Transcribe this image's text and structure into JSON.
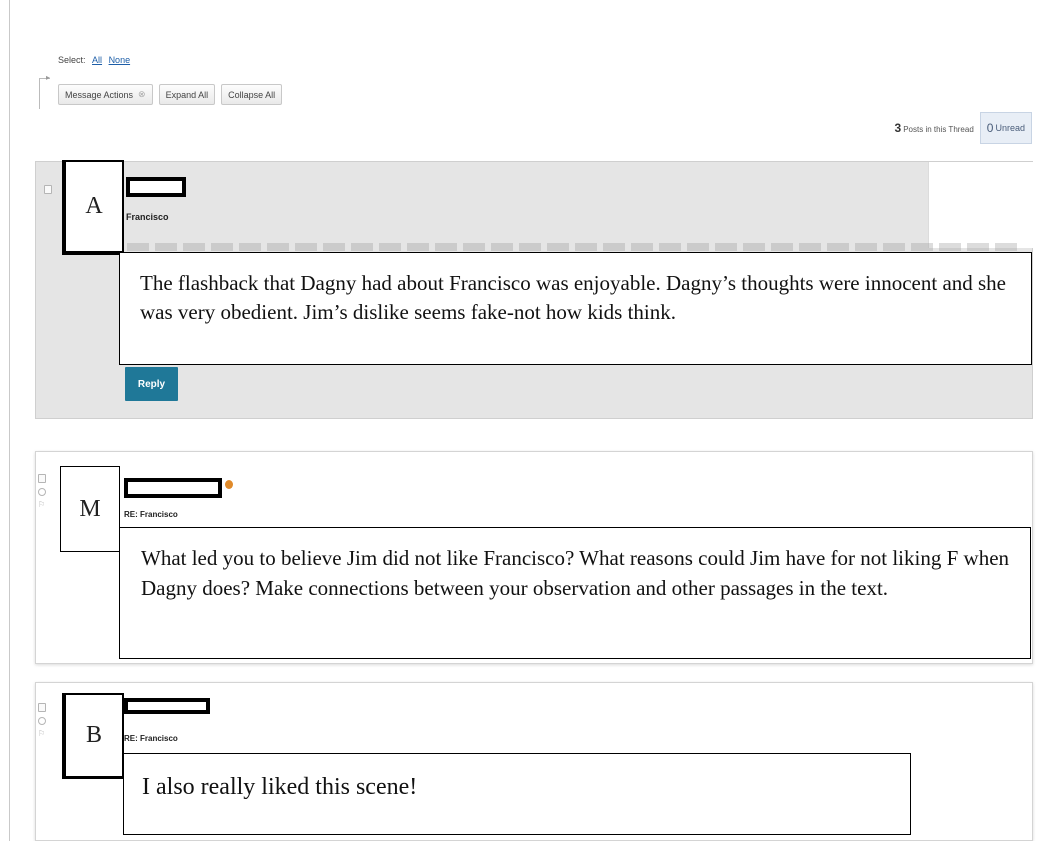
{
  "toolbar": {
    "select_label": "Select:",
    "select_all": "All",
    "select_none": "None",
    "message_actions": "Message Actions",
    "message_actions_icon": "close-icon",
    "expand_all": "Expand All",
    "collapse_all": "Collapse All"
  },
  "thread_info": {
    "posts_count": "3",
    "posts_label": "Posts in this Thread",
    "unread_count": "0",
    "unread_label": "Unread"
  },
  "posts": [
    {
      "marker": "A",
      "title": "Francisco",
      "callout": "The flashback that Dagny had about Francisco was enjoyable. Dagny’s thoughts were innocent and she was very obedient. Jim’s dislike seems fake-not how kids think.",
      "reply_label": "Reply"
    },
    {
      "marker": "M",
      "title": "RE: Francisco",
      "callout": "What led you to believe Jim did not like Francisco? What reasons could Jim have for not liking F when Dagny does? Make connections between your observation and other passages in the text."
    },
    {
      "marker": "B",
      "title": "RE: Francisco",
      "callout": "I also really liked this scene!"
    }
  ],
  "colors": {
    "reply_button": "#1f7898",
    "link": "#1d5ea8",
    "selected_post_bg": "#e5e5e5",
    "online_dot": "#e08a2a"
  }
}
